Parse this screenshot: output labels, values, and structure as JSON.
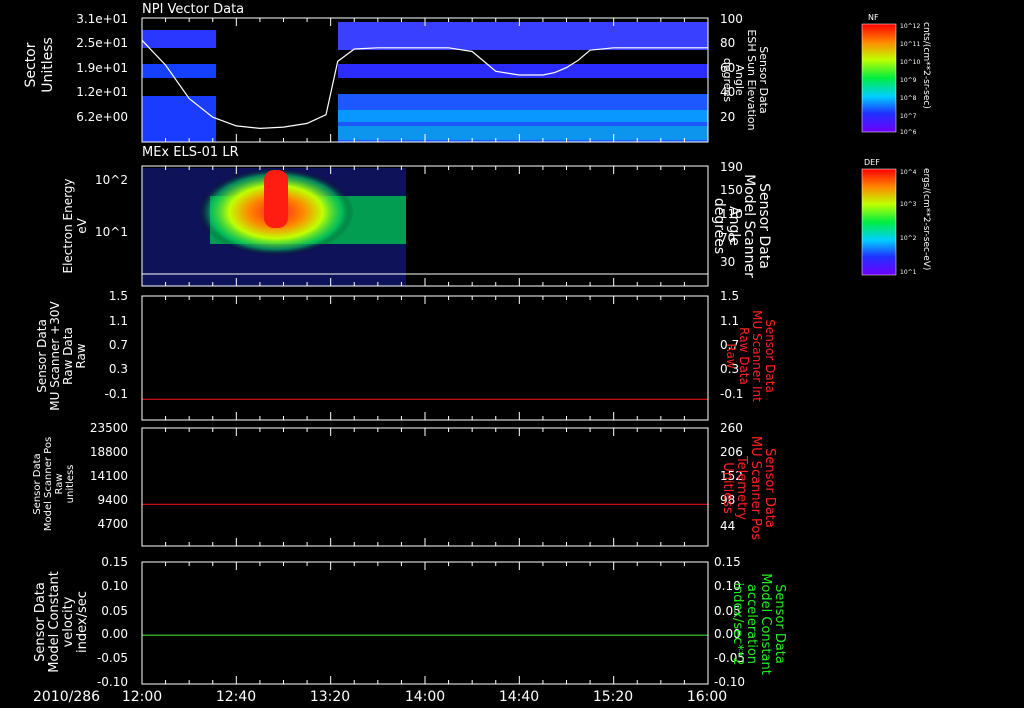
{
  "date_label": "2010/286",
  "time_ticks": [
    "12:00",
    "12:40",
    "13:20",
    "14:00",
    "14:40",
    "15:20",
    "16:00"
  ],
  "colors": {
    "background": "#000000",
    "axes": "#ffffff",
    "red_trace": "#dd1111",
    "green_trace": "#33dd33",
    "red_label": "#ff2020",
    "green_label": "#20ee20"
  },
  "panels": [
    {
      "id": "npi",
      "title": "NPI Vector Data",
      "left_label": [
        "Sector",
        "Unitless"
      ],
      "right_label": [
        "Sensor Data",
        "ESH Sun Elevation",
        "Angle",
        "degrees"
      ],
      "right_label_color": "#ffffff",
      "left_ticks": [
        "3.1e+01",
        "2.5e+01",
        "1.9e+01",
        "1.2e+01",
        "6.2e+00"
      ],
      "right_ticks": [
        "100",
        "80",
        "60",
        "40",
        "20"
      ],
      "colorbar": {
        "title": "NF",
        "ticks": [
          "10^12",
          "10^11",
          "10^10",
          "10^9",
          "10^8",
          "10^7",
          "10^6"
        ],
        "units": "cnts/(cm**2-sr-sec)"
      }
    },
    {
      "id": "els",
      "title": "MEx ELS-01 LR",
      "left_label": [
        "Electron Energy",
        "eV"
      ],
      "right_label": [
        "Sensor Data",
        "Model Scanner",
        "Angle",
        "degrees"
      ],
      "right_label_color": "#ffffff",
      "left_ticks": [
        "10^2",
        "10^1"
      ],
      "right_ticks": [
        "190",
        "150",
        "110",
        "70",
        "30"
      ],
      "colorbar": {
        "title": "DEF",
        "ticks": [
          "10^4",
          "10^3",
          "10^2",
          "10^1"
        ],
        "units": "ergs/(cm**2-sr-sec-eV)"
      }
    },
    {
      "id": "mu_raw",
      "left_label": [
        "Sensor Data",
        "MU Scanner +30V",
        "Raw Data",
        "Raw"
      ],
      "right_label": [
        "Sensor Data",
        "MU Scanner Int",
        "Raw Data",
        "Raw"
      ],
      "right_label_color": "#ff2020",
      "left_ticks": [
        "1.5",
        "1.1",
        "0.7",
        "0.3",
        "-0.1"
      ],
      "right_ticks": [
        "1.5",
        "1.1",
        "0.7",
        "0.3",
        "-0.1"
      ]
    },
    {
      "id": "mu_pos",
      "left_label": [
        "Sensor Data",
        "Model Scanner Pos",
        "Raw",
        "unitless"
      ],
      "right_label": [
        "Sensor Data",
        "MU Scanner Pos",
        "Telemetry",
        "Unitless"
      ],
      "right_label_color": "#ff2020",
      "left_ticks": [
        "23500",
        "18800",
        "14100",
        "9400",
        "4700"
      ],
      "right_ticks": [
        "260",
        "206",
        "152",
        "98",
        "44"
      ]
    },
    {
      "id": "model_const",
      "left_label": [
        "Sensor Data",
        "Model Constant",
        "velocity",
        "index/sec"
      ],
      "right_label": [
        "Sensor Data",
        "Model Constant",
        "acceleration",
        "index/sec**2"
      ],
      "right_label_color": "#20ee20",
      "left_ticks": [
        "0.15",
        "0.10",
        "0.05",
        "0.00",
        "-0.05",
        "-0.10"
      ],
      "right_ticks": [
        "0.15",
        "0.10",
        "0.05",
        "0.00",
        "-0.05",
        "-0.10"
      ]
    }
  ],
  "chart_data": [
    {
      "type": "heatmap",
      "title": "NPI Vector Data",
      "ylabel": "Sector Unitless",
      "y2label": "Sensor Data ESH Sun Elevation Angle degrees",
      "x_start": "12:00",
      "x_end": "16:00",
      "ylim": [
        0,
        31
      ],
      "y2lim": [
        0,
        100
      ],
      "y2_scale": "linear",
      "sun_elevation_line": {
        "x": [
          "12:00",
          "12:10",
          "12:20",
          "12:30",
          "12:40",
          "12:50",
          "13:00",
          "13:10",
          "13:18",
          "13:23",
          "13:30",
          "13:40",
          "13:50",
          "14:00",
          "14:10",
          "14:20",
          "14:30",
          "14:40",
          "14:50",
          "14:55",
          "15:00",
          "15:05",
          "15:10",
          "15:20",
          "15:30",
          "15:40",
          "15:50",
          "16:00"
        ],
        "y": [
          82,
          62,
          35,
          20,
          13,
          11,
          12,
          15,
          22,
          65,
          75,
          76,
          76,
          76,
          76,
          73,
          57,
          54,
          54,
          56,
          60,
          66,
          74,
          76,
          76,
          76,
          76,
          76
        ]
      },
      "data_gaps": [
        [
          "12:44",
          "13:18"
        ]
      ]
    },
    {
      "type": "heatmap",
      "title": "MEx ELS-01 LR",
      "ylabel": "Electron Energy eV",
      "y2label": "Sensor Data Model Scanner Angle degrees",
      "x_start": "12:00",
      "x_end": "16:00",
      "y_scale": "log",
      "y2lim": [
        0,
        190
      ],
      "coverage": [
        "12:00",
        "13:50"
      ],
      "peak_interval": [
        "12:50",
        "12:58"
      ],
      "scanner_angle_line": {
        "x": [
          "12:00",
          "16:00"
        ],
        "y": [
          14,
          14
        ]
      }
    },
    {
      "type": "line",
      "ylabel": "Sensor Data MU Scanner +30V Raw Data Raw",
      "y2label": "Sensor Data MU Scanner Int Raw Data Raw",
      "ylim": [
        -0.3,
        1.5
      ],
      "series": [
        {
          "x": [
            "12:00",
            "16:00"
          ],
          "y": [
            0,
            0
          ],
          "color": "#dd1111"
        }
      ]
    },
    {
      "type": "line",
      "ylabel": "Sensor Data Model Scanner Pos Raw unitless",
      "y2label": "Sensor Data MU Scanner Pos Telemetry Unitless",
      "ylim": [
        0,
        23500
      ],
      "y2lim": [
        0,
        260
      ],
      "series": [
        {
          "x": [
            "12:00",
            "16:00"
          ],
          "y": [
            8300,
            8300
          ],
          "color": "#dd1111"
        }
      ]
    },
    {
      "type": "line",
      "ylabel": "Sensor Data Model Constant velocity index/sec",
      "y2label": "Sensor Data Model Constant acceleration index/sec**2",
      "ylim": [
        -0.1,
        0.15
      ],
      "series": [
        {
          "x": [
            "12:00",
            "16:00"
          ],
          "y": [
            0,
            0
          ],
          "color": "#33dd33"
        }
      ]
    }
  ]
}
